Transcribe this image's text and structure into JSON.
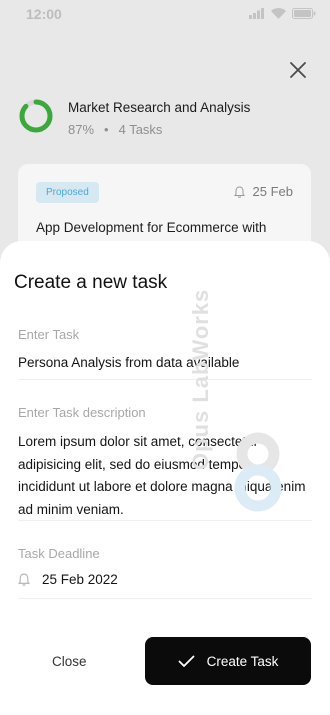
{
  "status_bar": {
    "time": "12:00"
  },
  "project": {
    "title": "Market Research and Analysis",
    "progress_label": "87%",
    "progress": 0.87,
    "separator": "•",
    "tasks_label": "4 Tasks"
  },
  "bg_card": {
    "badge": "Proposed",
    "date": "25 Feb",
    "title": "App Development for Ecommerce with"
  },
  "sheet": {
    "title": "Create a new task",
    "task_label": "Enter Task",
    "task_value": "Persona Analysis from data available",
    "desc_label": "Enter Task description",
    "desc_value": "Lorem ipsum dolor sit amet, consectetur adipisicing elit, sed do eiusmod tempor incididunt ut labore et dolore magna aliqua enim ad minim veniam.",
    "deadline_label": "Task Deadline",
    "deadline_value": "25 Feb 2022",
    "close_label": "Close",
    "create_label": "Create Task"
  },
  "watermark": {
    "text": "Opus LabWorks"
  },
  "colors": {
    "accent_green": "#3aa83a",
    "badge_bg": "#d6e9f3",
    "badge_text": "#4ea6d3",
    "primary_button": "#0b0b0b"
  }
}
